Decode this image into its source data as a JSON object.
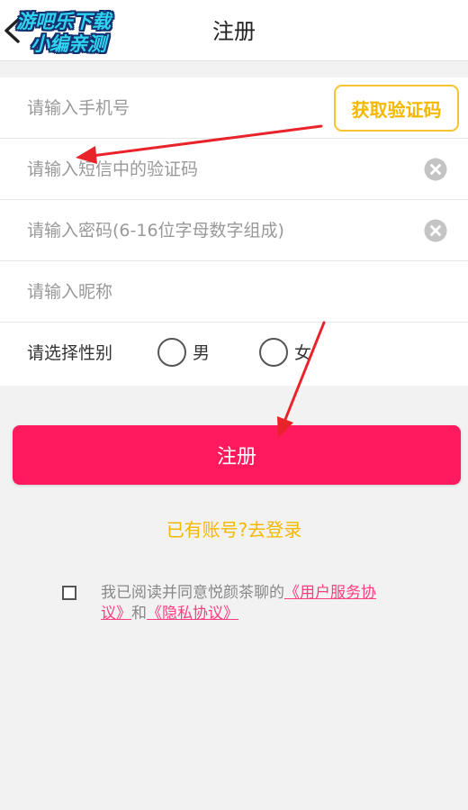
{
  "header": {
    "title": "注册",
    "watermark_line1": "游吧乐下载",
    "watermark_line2": "小编亲测"
  },
  "form": {
    "phone_placeholder": "请输入手机号",
    "get_code_label": "获取验证码",
    "sms_code_placeholder": "请输入短信中的验证码",
    "password_placeholder": "请输入密码(6-16位字母数字组成)",
    "nickname_placeholder": "请输入昵称",
    "gender_label": "请选择性别",
    "gender_male": "男",
    "gender_female": "女"
  },
  "register_label": "注册",
  "login_link": "已有账号?去登录",
  "agreement": {
    "prefix": "我已阅读并同意悦颜茶聊的",
    "user_agreement": "《用户服务协议》",
    "conjunction": "和",
    "privacy_policy": "《隐私协议》"
  },
  "colors": {
    "accent": "#ff1a5e",
    "code_button": "#f5b800",
    "link": "#ff3d7f",
    "annotation_arrow": "#e8242a"
  }
}
